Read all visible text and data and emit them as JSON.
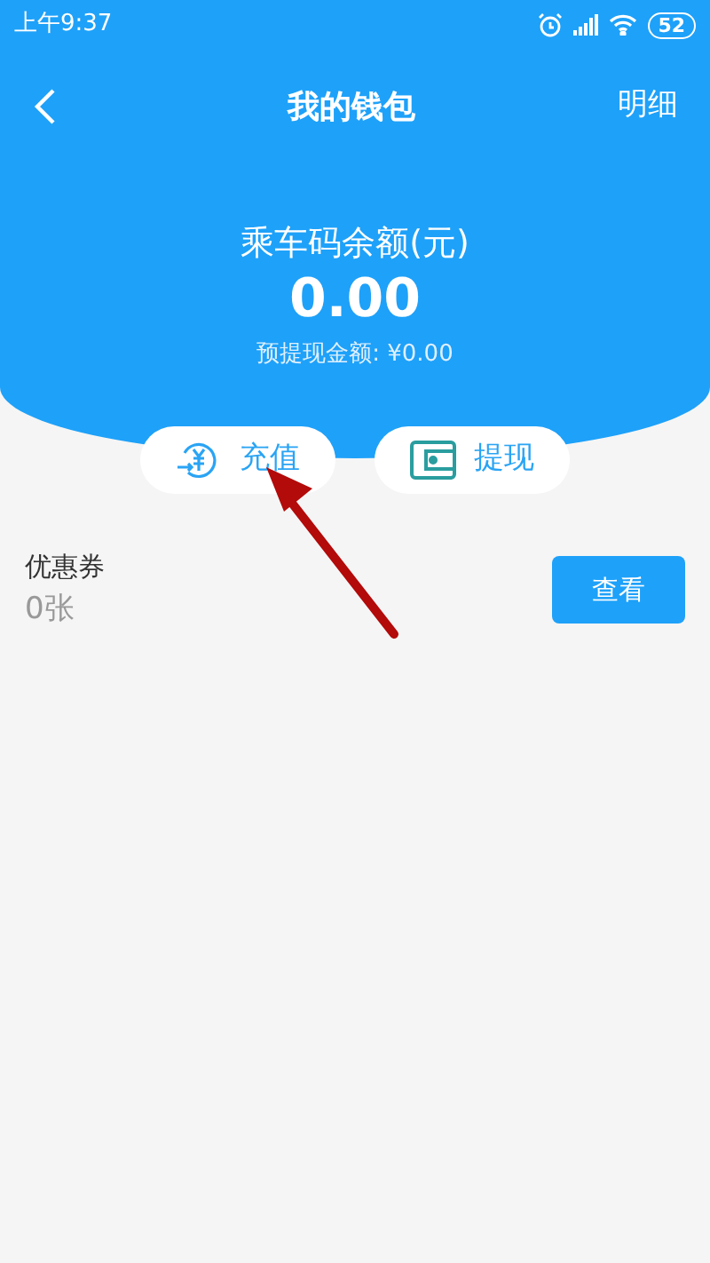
{
  "status_bar": {
    "time": "上午9:37",
    "battery": "52"
  },
  "nav": {
    "title": "我的钱包",
    "action": "明细"
  },
  "balance": {
    "label": "乘车码余额(元)",
    "amount": "0.00",
    "pending": "预提现金额: ¥0.00"
  },
  "actions": [
    {
      "kind": "recharge",
      "label": "充值"
    },
    {
      "kind": "withdraw",
      "label": "提现"
    }
  ],
  "coupon": {
    "label": "优惠券",
    "count": "0张",
    "button": "查看"
  }
}
